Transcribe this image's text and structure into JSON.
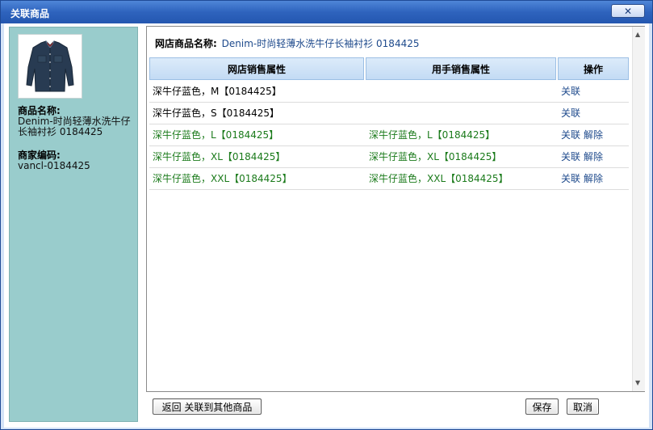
{
  "window": {
    "title": "关联商品",
    "close_glyph": "✕"
  },
  "sidebar": {
    "image_icon": "denim-shirt-image",
    "name_label": "商品名称:",
    "name_value": "Denim-时尚轻薄水洗牛仔长袖衬衫 0184425",
    "code_label": "商家编码:",
    "code_value": "vancl-0184425"
  },
  "panel": {
    "product_label": "网店商品名称:",
    "product_value": "Denim-时尚轻薄水洗牛仔长袖衬衫 0184425"
  },
  "table": {
    "headers": [
      "网店销售属性",
      "用手销售属性",
      "操作"
    ],
    "rows": [
      {
        "store_attr": "深牛仔蓝色，M【0184425】",
        "mapped_attr": "",
        "actions": [
          "关联"
        ],
        "linked": false
      },
      {
        "store_attr": "深牛仔蓝色，S【0184425】",
        "mapped_attr": "",
        "actions": [
          "关联"
        ],
        "linked": false
      },
      {
        "store_attr": "深牛仔蓝色，L【0184425】",
        "mapped_attr": "深牛仔蓝色，L【0184425】",
        "actions": [
          "关联",
          "解除"
        ],
        "linked": true
      },
      {
        "store_attr": "深牛仔蓝色，XL【0184425】",
        "mapped_attr": "深牛仔蓝色，XL【0184425】",
        "actions": [
          "关联",
          "解除"
        ],
        "linked": true
      },
      {
        "store_attr": "深牛仔蓝色，XXL【0184425】",
        "mapped_attr": "深牛仔蓝色，XXL【0184425】",
        "actions": [
          "关联",
          "解除"
        ],
        "linked": true
      }
    ]
  },
  "footer": {
    "back_label": "返回 关联到其他商品",
    "save_label": "保存",
    "cancel_label": "取消"
  },
  "colors": {
    "title_bar": "#2e63bd",
    "sidebar_bg": "#99cccc",
    "linked_text": "#1a7a1a",
    "link_text": "#1e4a8c"
  }
}
